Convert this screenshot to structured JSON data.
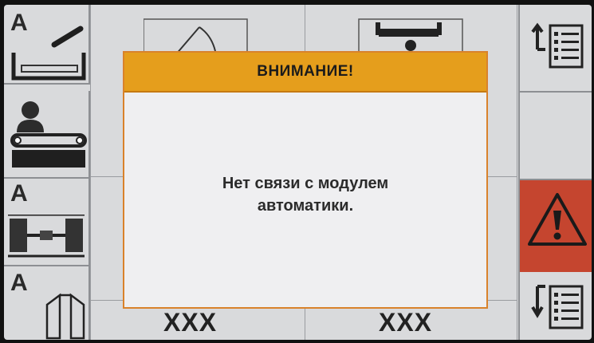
{
  "dialog": {
    "title": "ВНИМАНИЕ!",
    "message_line1": "Нет связи с модулем",
    "message_line2": "автоматики."
  },
  "left_panel": {
    "items": [
      {
        "icon": "auto-spreader-icon",
        "label": "A"
      },
      {
        "icon": "operator-conveyor-icon",
        "label": ""
      },
      {
        "icon": "auto-axle-icon",
        "label": "A"
      },
      {
        "icon": "auto-gate-icon",
        "label": "A"
      }
    ]
  },
  "right_panel": {
    "items": [
      {
        "icon": "menu-up-list-icon"
      },
      {
        "icon": "warning-icon"
      },
      {
        "icon": "menu-down-list-icon"
      }
    ]
  },
  "bottom_values": {
    "value_left": "XXX",
    "value_right": "XXX"
  },
  "colors": {
    "header": "#e59e1c",
    "dialog_border": "#d9822b",
    "warning_background": "#c5452f",
    "screen_background": "#d9dadc"
  }
}
